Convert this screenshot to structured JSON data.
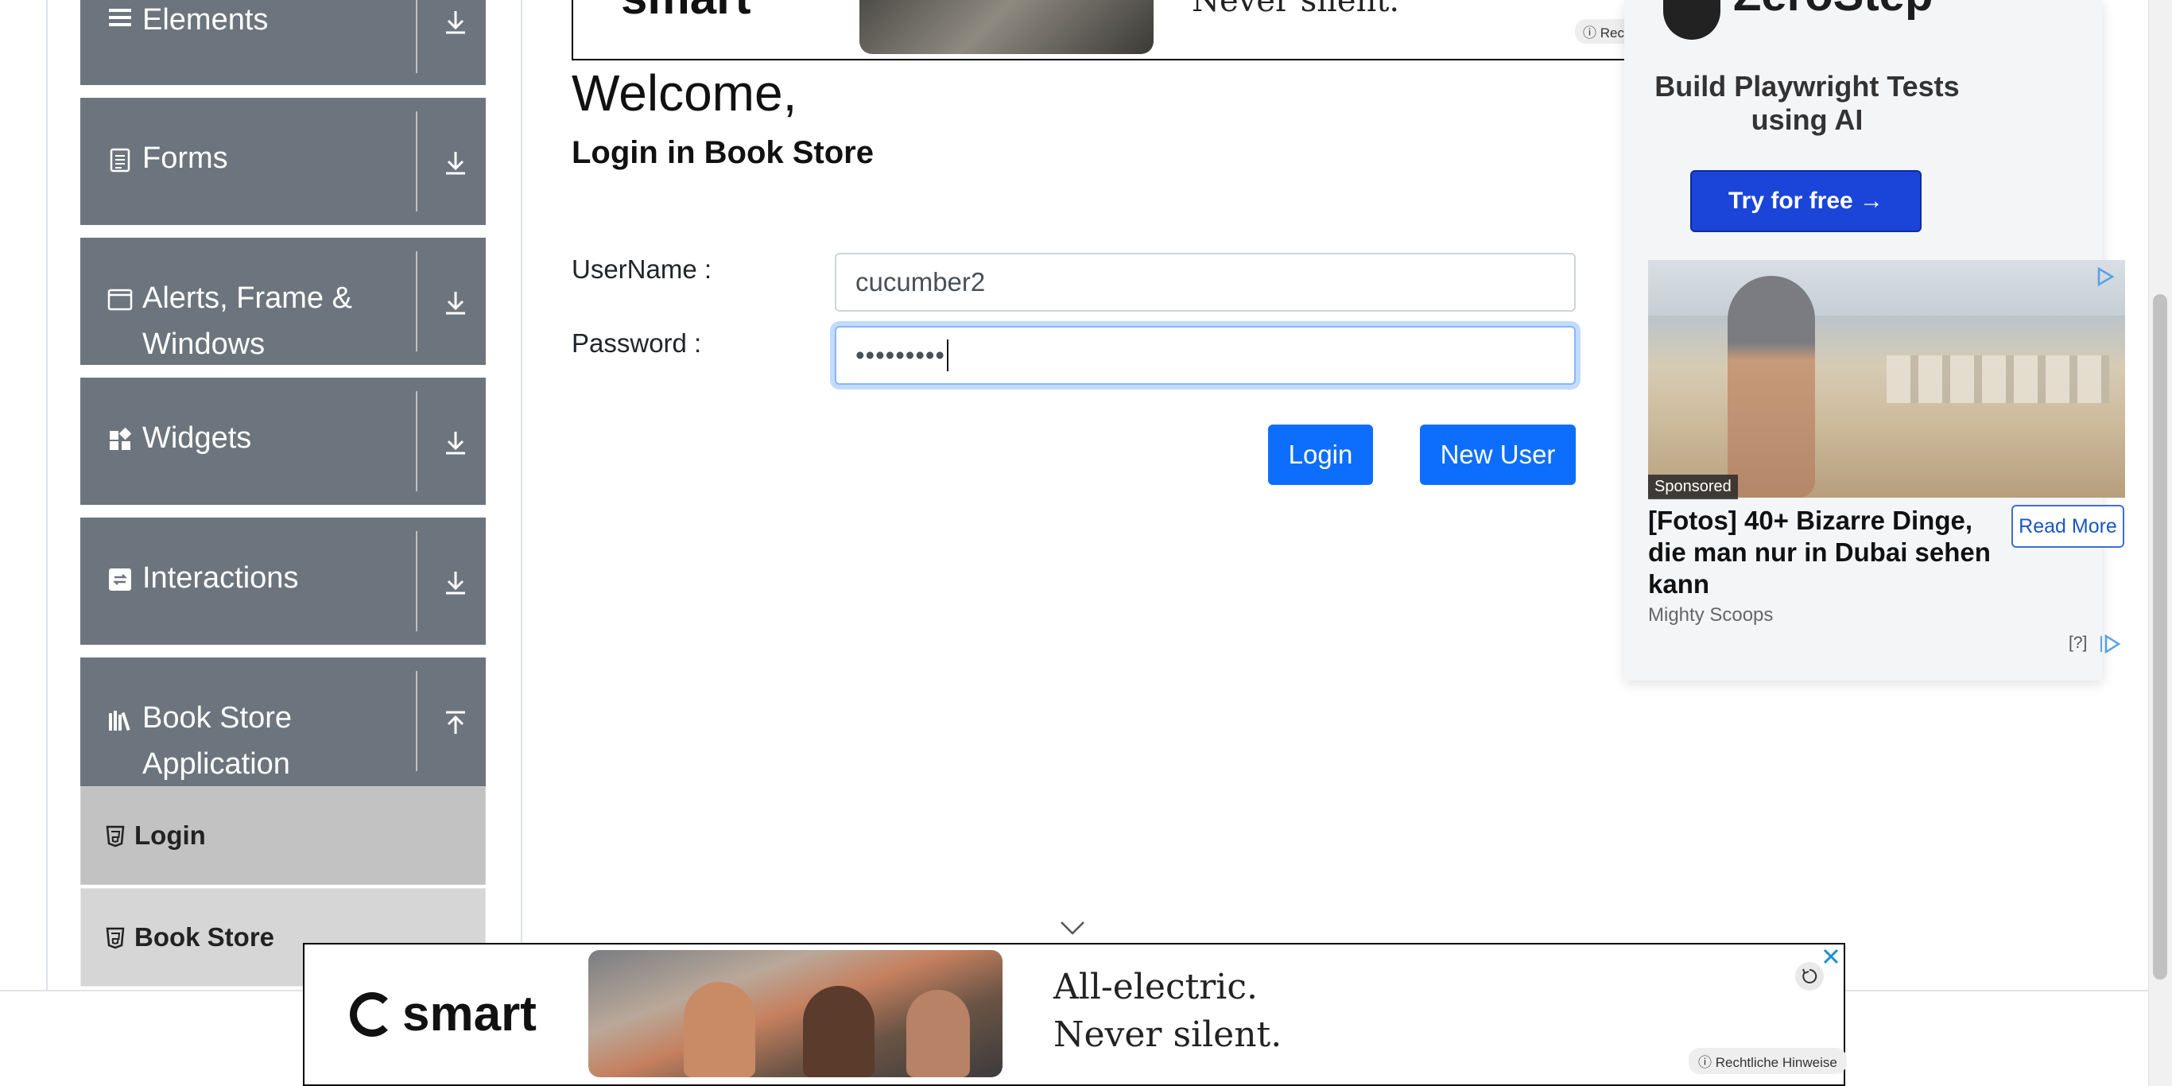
{
  "sidebar": {
    "groups": [
      {
        "label": "Elements",
        "icon": "hamburger-icon",
        "arrow": "download-arrow-icon"
      },
      {
        "label": "Forms",
        "icon": "document-icon",
        "arrow": "download-arrow-icon"
      },
      {
        "label_line1": "Alerts, Frame &",
        "label_line2": "Windows",
        "icon": "window-icon",
        "arrow": "download-arrow-icon"
      },
      {
        "label": "Widgets",
        "icon": "widgets-icon",
        "arrow": "download-arrow-icon"
      },
      {
        "label": "Interactions",
        "icon": "interactions-icon",
        "arrow": "download-arrow-icon"
      },
      {
        "label_line1": "Book Store",
        "label_line2": "Application",
        "icon": "books-icon",
        "arrow": "upload-arrow-icon"
      }
    ],
    "items": [
      {
        "label": "Login",
        "icon": "html5-icon",
        "active": true
      },
      {
        "label": "Book Store",
        "icon": "html5-icon",
        "active": false
      }
    ]
  },
  "main": {
    "welcome": "Welcome,",
    "subtitle": "Login in Book Store",
    "username_label": "UserName :",
    "username_value": "cucumber2",
    "password_label": "Password :",
    "password_value": "•••••••••",
    "login_button": "Login",
    "new_user_button": "New User"
  },
  "ads": {
    "top": {
      "slogan": "Never silent.",
      "logo": "smart",
      "legal": "Rech"
    },
    "right": {
      "brand": "ZeroStep",
      "headline": "Build Playwright Tests using AI",
      "cta": "Try for free →",
      "sponsored_tag": "Sponsored",
      "sponsored_title": "[Fotos] 40+ Bizarre Dinge, die man nur in Dubai sehen kann",
      "read_more": "Read More",
      "source": "Mighty Scoops",
      "help": "[?]"
    },
    "bottom": {
      "logo": "smart",
      "line1": "All-electric.",
      "line2": "Never silent.",
      "legal": "Rechtliche Hinweise"
    }
  },
  "colors": {
    "sidebar_group_bg": "#6c757d",
    "primary_button": "#0d6efd",
    "active_item_bg": "#c2c2c2",
    "item_bg": "#d6d6d6"
  }
}
